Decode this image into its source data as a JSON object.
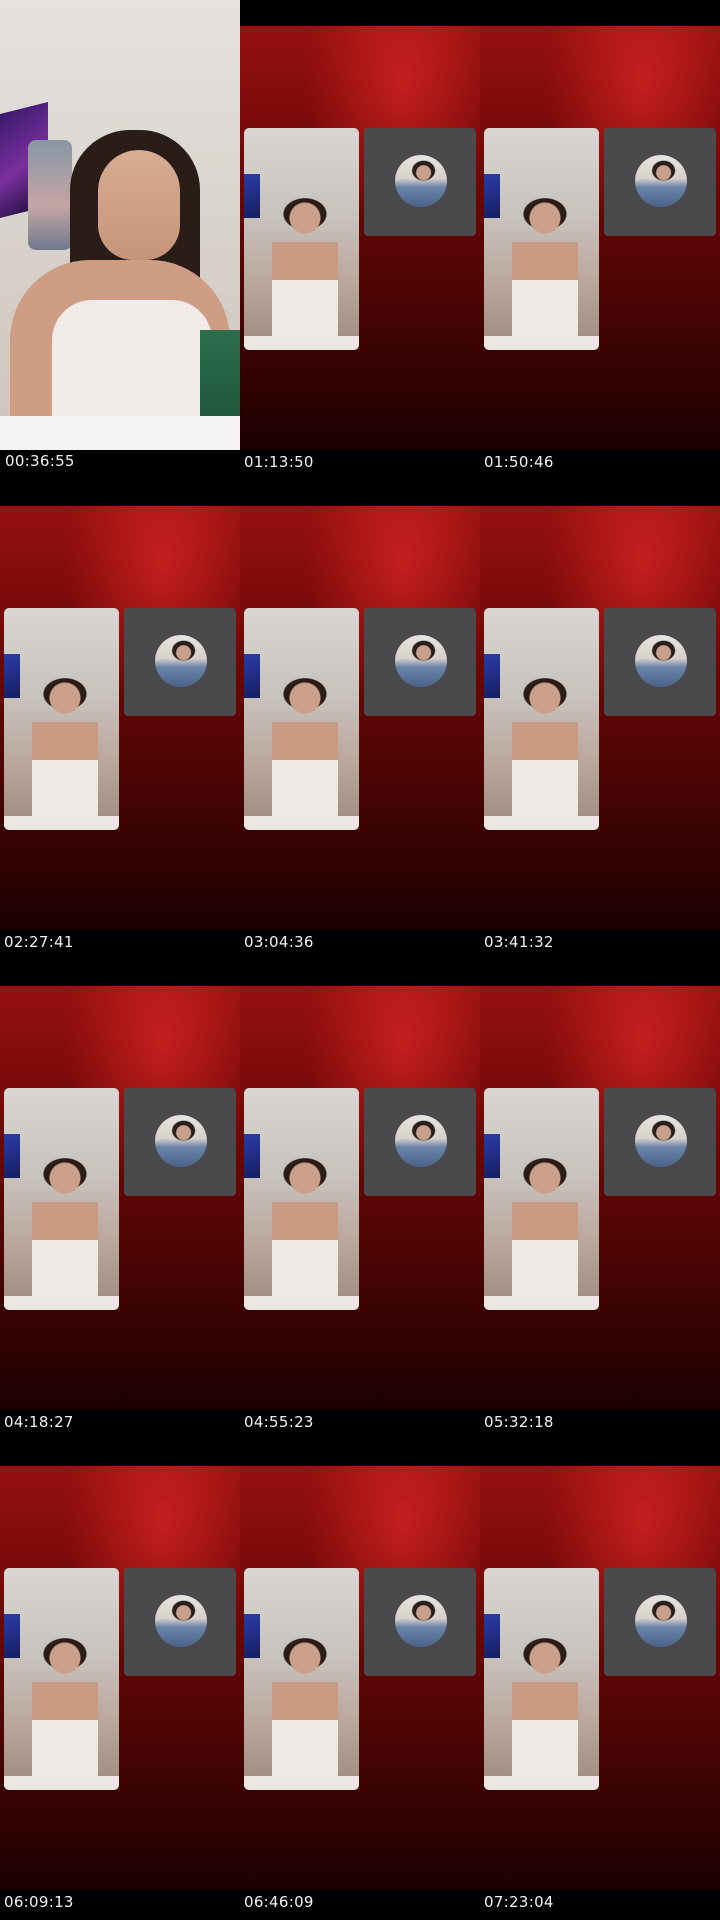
{
  "thumbnails": [
    {
      "timestamp": "00:36:55",
      "kind": "selfie"
    },
    {
      "timestamp": "01:13:50",
      "kind": "split"
    },
    {
      "timestamp": "01:50:46",
      "kind": "split"
    },
    {
      "timestamp": "02:27:41",
      "kind": "split"
    },
    {
      "timestamp": "03:04:36",
      "kind": "split"
    },
    {
      "timestamp": "03:41:32",
      "kind": "split"
    },
    {
      "timestamp": "04:18:27",
      "kind": "split"
    },
    {
      "timestamp": "04:55:23",
      "kind": "split"
    },
    {
      "timestamp": "05:32:18",
      "kind": "split"
    },
    {
      "timestamp": "06:09:13",
      "kind": "split"
    },
    {
      "timestamp": "06:46:09",
      "kind": "split"
    },
    {
      "timestamp": "07:23:04",
      "kind": "split"
    }
  ],
  "colors": {
    "background": "#000000",
    "stream_red": "#8b0e0e",
    "cam_panel": "#4a4a4c",
    "timestamp_text": "#f2f2f2"
  }
}
